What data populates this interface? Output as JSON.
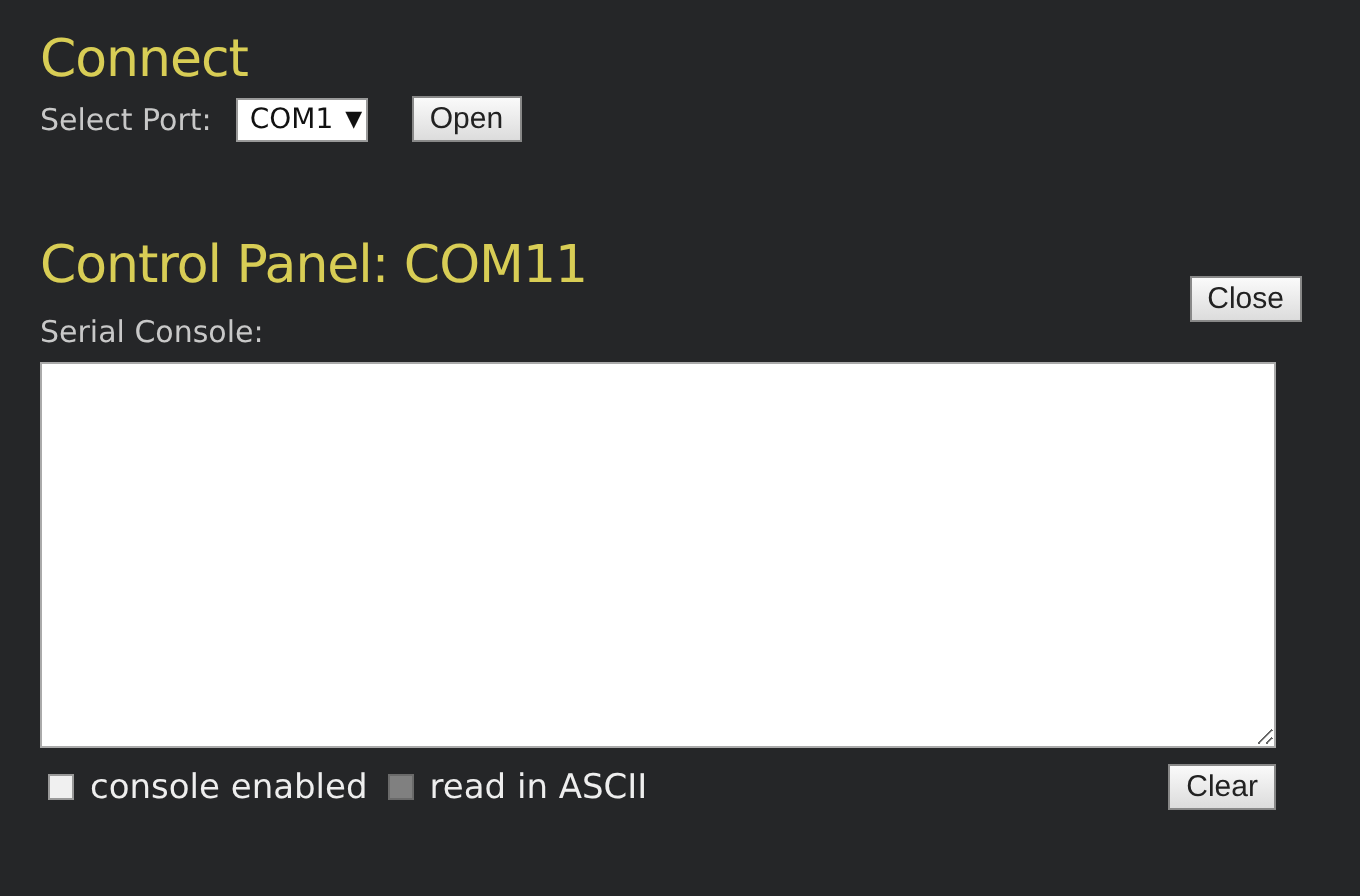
{
  "connect": {
    "title": "Connect",
    "port_label": "Select Port:",
    "port_value": "COM1",
    "port_caret": "▼",
    "open_button": "Open"
  },
  "control_panel": {
    "title": "Control Panel: COM11",
    "close_button": "Close",
    "console_label": "Serial Console:",
    "options": [
      {
        "label": "console enabled",
        "checked": false,
        "disabled": false
      },
      {
        "label": "read in ASCII",
        "checked": false,
        "disabled": true
      }
    ],
    "clear_button": "Clear"
  }
}
